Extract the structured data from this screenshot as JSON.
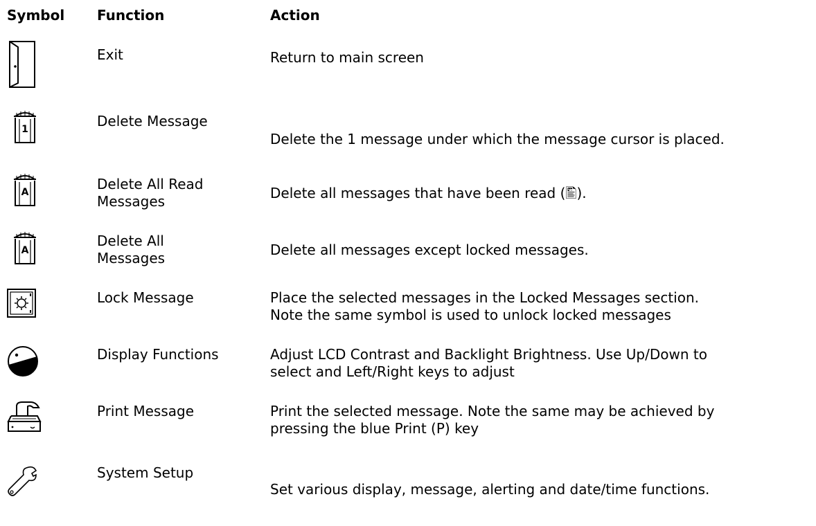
{
  "headers": {
    "symbol": "Symbol",
    "function": "Function",
    "action": "Action"
  },
  "rows": [
    {
      "icon": "exit-door-icon",
      "function_lines": [
        "Exit"
      ],
      "action_lines": [
        "Return to main screen"
      ]
    },
    {
      "icon": "delete-one-message-icon",
      "icon_label": "1",
      "function_lines": [
        "Delete Message"
      ],
      "action_lines": [
        "Delete the 1 message under which the message cursor is placed."
      ]
    },
    {
      "icon": "delete-all-read-messages-icon",
      "icon_label": "A",
      "function_lines": [
        "Delete All Read",
        "Messages"
      ],
      "action_lines": [
        "Delete all messages that have been read (🖺)."
      ]
    },
    {
      "icon": "delete-all-messages-icon",
      "icon_label": "A",
      "function_lines": [
        "Delete All",
        "Messages"
      ],
      "action_lines": [
        "Delete all messages except locked messages."
      ]
    },
    {
      "icon": "lock-message-safe-icon",
      "function_lines": [
        "Lock Message"
      ],
      "action_lines": [
        "Place the selected messages in the Locked Messages section.",
        "Note the same symbol is used to unlock locked messages"
      ]
    },
    {
      "icon": "display-functions-contrast-icon",
      "function_lines": [
        "Display Functions"
      ],
      "action_lines": [
        "Adjust LCD Contrast and Backlight Brightness.  Use Up/Down to",
        "select and Left/Right keys to adjust"
      ]
    },
    {
      "icon": "print-message-printer-icon",
      "function_lines": [
        "Print Message"
      ],
      "action_lines": [
        "Print the selected message.  Note the same may be achieved by",
        "pressing the blue Print (P) key"
      ]
    },
    {
      "icon": "system-setup-wrench-icon",
      "function_lines": [
        "System Setup"
      ],
      "action_lines": [
        "Set various display, message, alerting and date/time functions."
      ]
    }
  ]
}
